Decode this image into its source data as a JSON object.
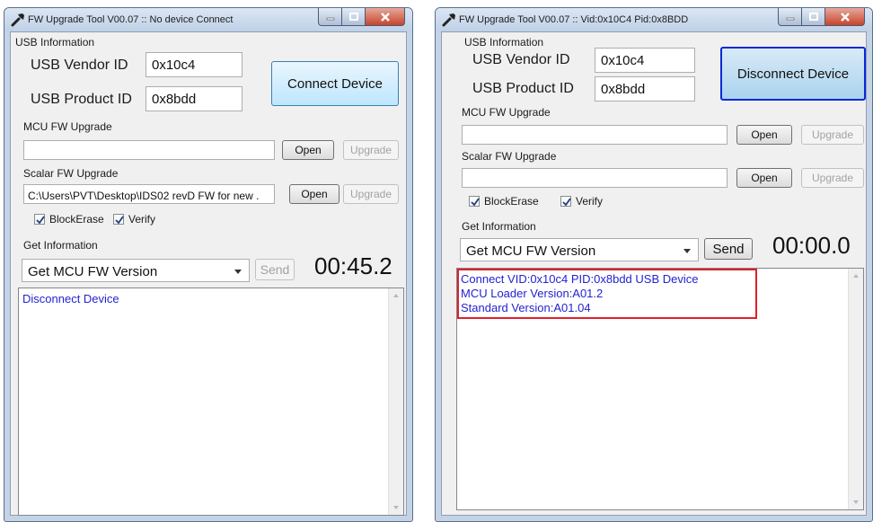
{
  "windows": [
    {
      "title": "FW Upgrade Tool V00.07 :: No device Connect",
      "usb": {
        "section_label": "USB Information",
        "vendor_label": "USB Vendor ID",
        "vendor_value": "0x10c4",
        "product_label": "USB Product ID",
        "product_value": "0x8bdd",
        "connect_button": "Connect Device"
      },
      "mcu": {
        "section_label": "MCU FW Upgrade",
        "path": "",
        "open_button": "Open",
        "upgrade_button": "Upgrade"
      },
      "scalar": {
        "section_label": "Scalar FW Upgrade",
        "path": "C:\\Users\\PVT\\Desktop\\IDS02 revD FW for new .",
        "open_button": "Open",
        "upgrade_button": "Upgrade",
        "block_erase_label": "BlockErase",
        "block_erase_checked": true,
        "verify_label": "Verify",
        "verify_checked": true
      },
      "info": {
        "section_label": "Get Information",
        "selected": "Get MCU FW Version",
        "send_button": "Send",
        "timer": "00:45.2"
      },
      "log": "Disconnect Device"
    },
    {
      "title": "FW Upgrade Tool V00.07 :: Vid:0x10C4 Pid:0x8BDD",
      "usb": {
        "section_label": "USB Information",
        "vendor_label": "USB Vendor ID",
        "vendor_value": "0x10c4",
        "product_label": "USB Product ID",
        "product_value": "0x8bdd",
        "connect_button": "Disconnect Device"
      },
      "mcu": {
        "section_label": "MCU FW Upgrade",
        "path": "",
        "open_button": "Open",
        "upgrade_button": "Upgrade"
      },
      "scalar": {
        "section_label": "Scalar FW Upgrade",
        "path": "",
        "open_button": "Open",
        "upgrade_button": "Upgrade",
        "block_erase_label": "BlockErase",
        "block_erase_checked": true,
        "verify_label": "Verify",
        "verify_checked": true
      },
      "info": {
        "section_label": "Get Information",
        "selected": "Get MCU FW Version",
        "send_button": "Send",
        "timer": "00:00.0"
      },
      "log": "Connect VID:0x10c4 PID:0x8bdd USB Device\nMCU Loader Version:A01.2\nStandard Version:A01.04"
    }
  ],
  "colors": {
    "log_text": "#2222d4",
    "highlight_box": "#e0202a",
    "focus_border": "#0b28d8"
  }
}
